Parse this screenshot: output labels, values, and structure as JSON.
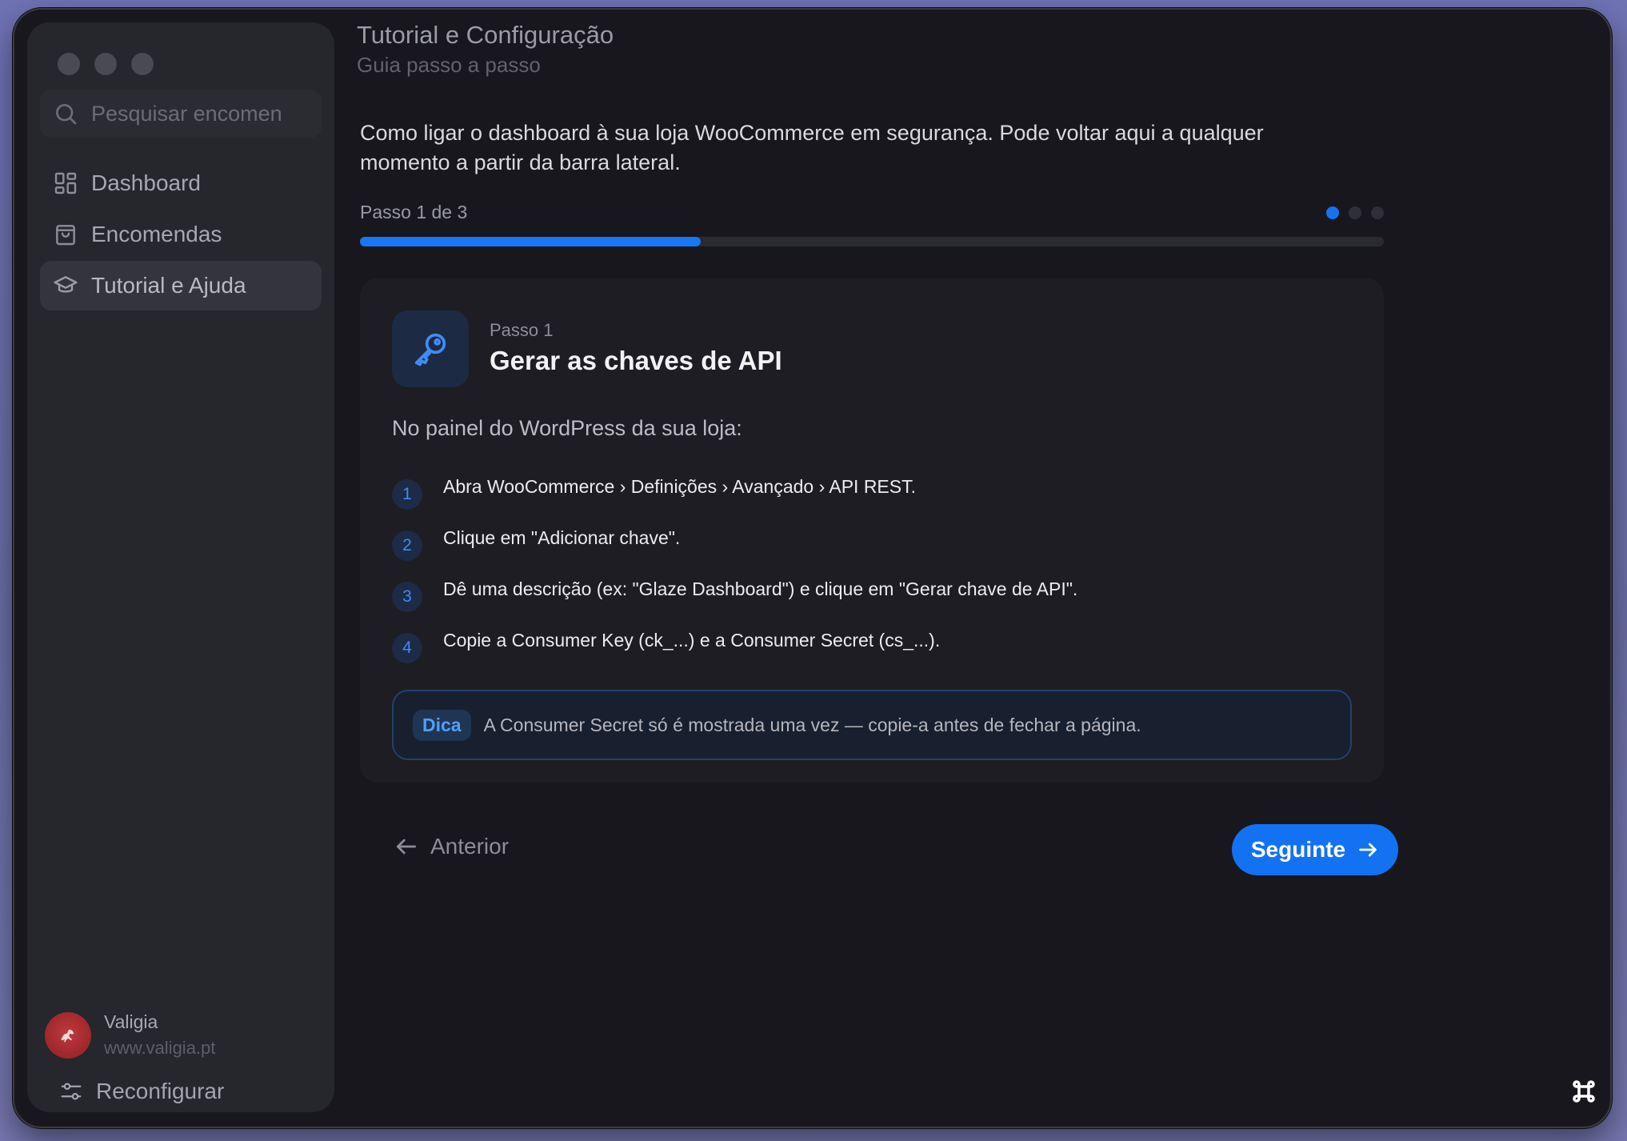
{
  "sidebar": {
    "search_placeholder": "Pesquisar encomen",
    "items": [
      {
        "label": "Dashboard",
        "icon": "grid-icon"
      },
      {
        "label": "Encomendas",
        "icon": "bag-icon"
      },
      {
        "label": "Tutorial e Ajuda",
        "icon": "graduation-cap-icon",
        "active": true
      }
    ],
    "store": {
      "name": "Valigia",
      "url": "www.valigia.pt",
      "avatar_text": "Cavalinho"
    },
    "reconfigure_label": "Reconfigurar"
  },
  "header": {
    "title": "Tutorial e Configuração",
    "subtitle": "Guia passo a passo"
  },
  "intro": "Como ligar o dashboard à sua loja WooCommerce em segurança. Pode voltar aqui a qualquer momento a partir da barra lateral.",
  "progress": {
    "label": "Passo 1 de 3",
    "current": 1,
    "total": 3,
    "fraction": 0.333
  },
  "card": {
    "step_label": "Passo 1",
    "title": "Gerar as chaves de API",
    "lead": "No painel do WordPress da sua loja:",
    "steps": [
      {
        "num": "1",
        "text": "Abra WooCommerce › Definições › Avançado › API REST."
      },
      {
        "num": "2",
        "text": "Clique em \"Adicionar chave\"."
      },
      {
        "num": "3",
        "text": "Dê uma descrição (ex: \"Glaze Dashboard\") e clique em \"Gerar chave de API\"."
      },
      {
        "num": "4",
        "text": "Copie a Consumer Key (ck_...) e a Consumer Secret (cs_...)."
      }
    ],
    "tip": {
      "badge": "Dica",
      "text": "A Consumer Secret só é mostrada uma vez — copie-a antes de fechar a página."
    }
  },
  "nav_buttons": {
    "prev_label": "Anterior",
    "next_label": "Seguinte"
  },
  "colors": {
    "accent": "#1272f2",
    "background": "#17171d",
    "sidebar": "#26262d"
  }
}
